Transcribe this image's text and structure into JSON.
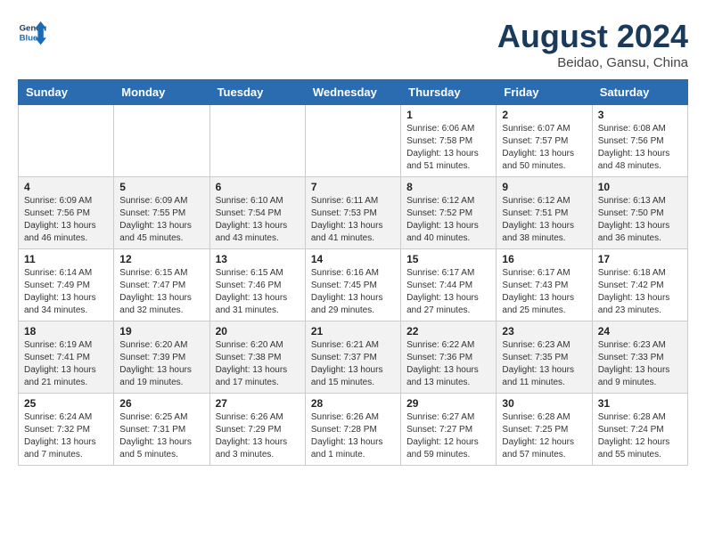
{
  "header": {
    "logo_line1": "General",
    "logo_line2": "Blue",
    "month_year": "August 2024",
    "location": "Beidao, Gansu, China"
  },
  "weekdays": [
    "Sunday",
    "Monday",
    "Tuesday",
    "Wednesday",
    "Thursday",
    "Friday",
    "Saturday"
  ],
  "weeks": [
    [
      {
        "day": "",
        "info": ""
      },
      {
        "day": "",
        "info": ""
      },
      {
        "day": "",
        "info": ""
      },
      {
        "day": "",
        "info": ""
      },
      {
        "day": "1",
        "sunrise": "6:06 AM",
        "sunset": "7:58 PM",
        "daylight": "13 hours and 51 minutes."
      },
      {
        "day": "2",
        "sunrise": "6:07 AM",
        "sunset": "7:57 PM",
        "daylight": "13 hours and 50 minutes."
      },
      {
        "day": "3",
        "sunrise": "6:08 AM",
        "sunset": "7:56 PM",
        "daylight": "13 hours and 48 minutes."
      }
    ],
    [
      {
        "day": "4",
        "sunrise": "6:09 AM",
        "sunset": "7:56 PM",
        "daylight": "13 hours and 46 minutes."
      },
      {
        "day": "5",
        "sunrise": "6:09 AM",
        "sunset": "7:55 PM",
        "daylight": "13 hours and 45 minutes."
      },
      {
        "day": "6",
        "sunrise": "6:10 AM",
        "sunset": "7:54 PM",
        "daylight": "13 hours and 43 minutes."
      },
      {
        "day": "7",
        "sunrise": "6:11 AM",
        "sunset": "7:53 PM",
        "daylight": "13 hours and 41 minutes."
      },
      {
        "day": "8",
        "sunrise": "6:12 AM",
        "sunset": "7:52 PM",
        "daylight": "13 hours and 40 minutes."
      },
      {
        "day": "9",
        "sunrise": "6:12 AM",
        "sunset": "7:51 PM",
        "daylight": "13 hours and 38 minutes."
      },
      {
        "day": "10",
        "sunrise": "6:13 AM",
        "sunset": "7:50 PM",
        "daylight": "13 hours and 36 minutes."
      }
    ],
    [
      {
        "day": "11",
        "sunrise": "6:14 AM",
        "sunset": "7:49 PM",
        "daylight": "13 hours and 34 minutes."
      },
      {
        "day": "12",
        "sunrise": "6:15 AM",
        "sunset": "7:47 PM",
        "daylight": "13 hours and 32 minutes."
      },
      {
        "day": "13",
        "sunrise": "6:15 AM",
        "sunset": "7:46 PM",
        "daylight": "13 hours and 31 minutes."
      },
      {
        "day": "14",
        "sunrise": "6:16 AM",
        "sunset": "7:45 PM",
        "daylight": "13 hours and 29 minutes."
      },
      {
        "day": "15",
        "sunrise": "6:17 AM",
        "sunset": "7:44 PM",
        "daylight": "13 hours and 27 minutes."
      },
      {
        "day": "16",
        "sunrise": "6:17 AM",
        "sunset": "7:43 PM",
        "daylight": "13 hours and 25 minutes."
      },
      {
        "day": "17",
        "sunrise": "6:18 AM",
        "sunset": "7:42 PM",
        "daylight": "13 hours and 23 minutes."
      }
    ],
    [
      {
        "day": "18",
        "sunrise": "6:19 AM",
        "sunset": "7:41 PM",
        "daylight": "13 hours and 21 minutes."
      },
      {
        "day": "19",
        "sunrise": "6:20 AM",
        "sunset": "7:39 PM",
        "daylight": "13 hours and 19 minutes."
      },
      {
        "day": "20",
        "sunrise": "6:20 AM",
        "sunset": "7:38 PM",
        "daylight": "13 hours and 17 minutes."
      },
      {
        "day": "21",
        "sunrise": "6:21 AM",
        "sunset": "7:37 PM",
        "daylight": "13 hours and 15 minutes."
      },
      {
        "day": "22",
        "sunrise": "6:22 AM",
        "sunset": "7:36 PM",
        "daylight": "13 hours and 13 minutes."
      },
      {
        "day": "23",
        "sunrise": "6:23 AM",
        "sunset": "7:35 PM",
        "daylight": "13 hours and 11 minutes."
      },
      {
        "day": "24",
        "sunrise": "6:23 AM",
        "sunset": "7:33 PM",
        "daylight": "13 hours and 9 minutes."
      }
    ],
    [
      {
        "day": "25",
        "sunrise": "6:24 AM",
        "sunset": "7:32 PM",
        "daylight": "13 hours and 7 minutes."
      },
      {
        "day": "26",
        "sunrise": "6:25 AM",
        "sunset": "7:31 PM",
        "daylight": "13 hours and 5 minutes."
      },
      {
        "day": "27",
        "sunrise": "6:26 AM",
        "sunset": "7:29 PM",
        "daylight": "13 hours and 3 minutes."
      },
      {
        "day": "28",
        "sunrise": "6:26 AM",
        "sunset": "7:28 PM",
        "daylight": "13 hours and 1 minute."
      },
      {
        "day": "29",
        "sunrise": "6:27 AM",
        "sunset": "7:27 PM",
        "daylight": "12 hours and 59 minutes."
      },
      {
        "day": "30",
        "sunrise": "6:28 AM",
        "sunset": "7:25 PM",
        "daylight": "12 hours and 57 minutes."
      },
      {
        "day": "31",
        "sunrise": "6:28 AM",
        "sunset": "7:24 PM",
        "daylight": "12 hours and 55 minutes."
      }
    ]
  ]
}
